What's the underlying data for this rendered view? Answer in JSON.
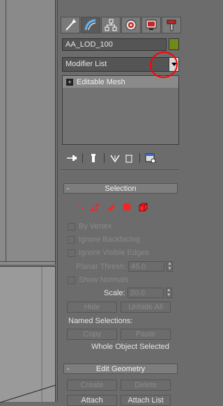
{
  "object": {
    "name": "AA_LOD_100",
    "color": "#6f8a1b"
  },
  "tabs": [
    {
      "icon": "create-wand-icon"
    },
    {
      "icon": "modify-arc-icon"
    },
    {
      "icon": "hierarchy-icon"
    },
    {
      "icon": "motion-icon"
    },
    {
      "icon": "display-monitor-icon"
    },
    {
      "icon": "utilities-hammer-icon"
    }
  ],
  "modifier_list": {
    "value": "Modifier List"
  },
  "stack": {
    "items": [
      {
        "label": "Editable Mesh"
      }
    ]
  },
  "selection": {
    "title": "Selection",
    "by_vertex": "By Vertex",
    "ignore_backfacing": "Ignore Backfacing",
    "ignore_visible_edges": "Ignore Visible Edges",
    "planar_thresh_label": "Planar Thresh:",
    "planar_thresh_value": "45.0",
    "show_normals": "Show Normals",
    "scale_label": "Scale:",
    "scale_value": "20.0",
    "hide": "Hide",
    "unhide_all": "Unhide All",
    "named_selections": "Named Selections:",
    "copy": "Copy",
    "paste": "Paste",
    "status": "Whole Object Selected"
  },
  "edit_geometry": {
    "title": "Edit Geometry",
    "create": "Create",
    "delete": "Delete",
    "attach": "Attach",
    "attach_list": "Attach List"
  },
  "colors": {
    "accent_red": "#ff0000",
    "rollout_header": "#7d7d7d"
  }
}
